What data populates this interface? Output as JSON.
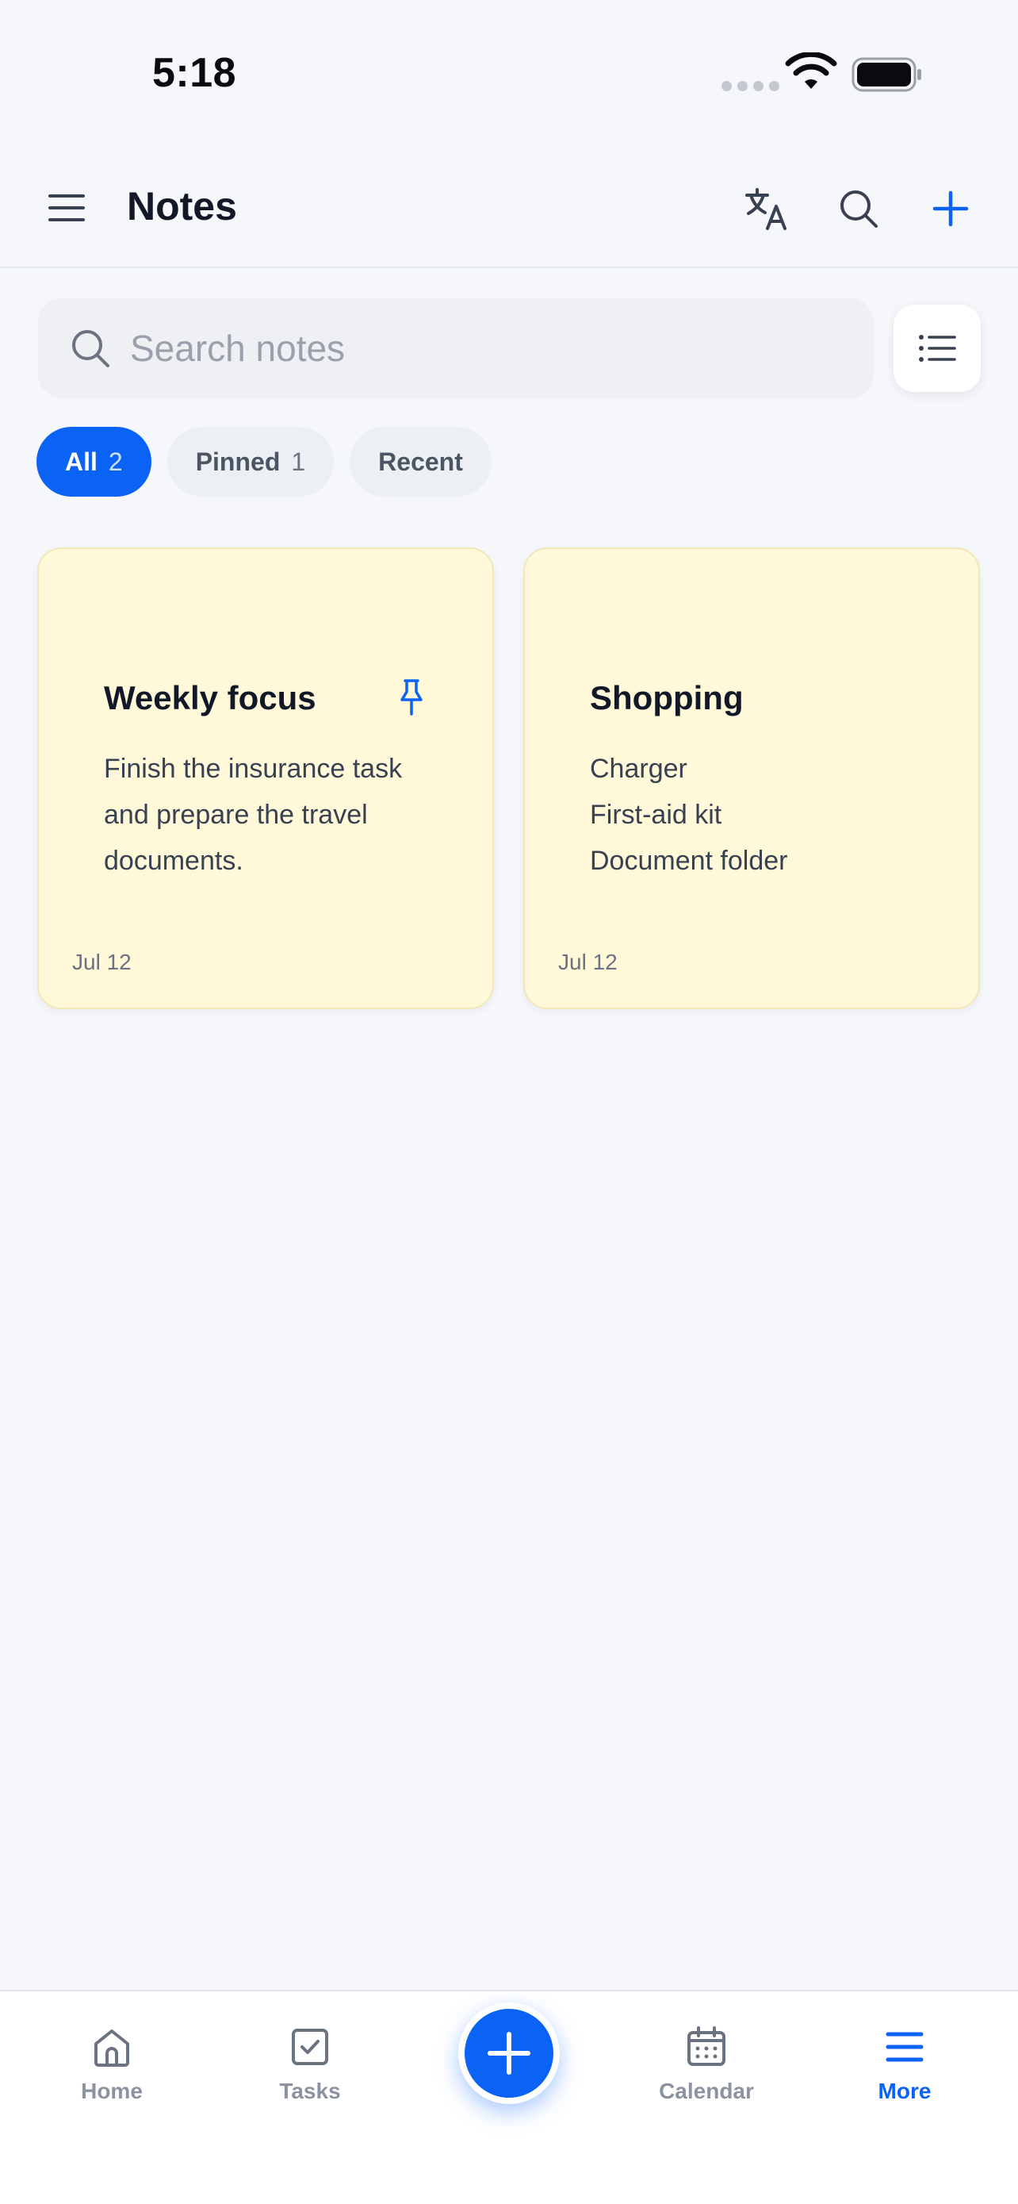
{
  "status_bar": {
    "time": "5:18"
  },
  "header": {
    "title": "Notes"
  },
  "search": {
    "placeholder": "Search notes",
    "value": ""
  },
  "filters": [
    {
      "label": "All",
      "count": "2",
      "active": true
    },
    {
      "label": "Pinned",
      "count": "1",
      "active": false
    },
    {
      "label": "Recent",
      "count": "",
      "active": false
    }
  ],
  "notes": [
    {
      "title": "Weekly focus",
      "pinned": true,
      "body": "Finish the insurance task and prepare the travel documents.",
      "date": "Jul 12",
      "color": "#fff8d9"
    },
    {
      "title": "Shopping",
      "pinned": false,
      "lines": [
        "Charger",
        "First-aid kit",
        "Document folder"
      ],
      "date": "Jul 12",
      "color": "#fff8d9"
    }
  ],
  "bottom_nav": {
    "items": [
      {
        "label": "Home",
        "icon": "home-icon",
        "active": false
      },
      {
        "label": "Tasks",
        "icon": "checkbox-icon",
        "active": false
      },
      {
        "label": "Calendar",
        "icon": "calendar-icon",
        "active": false
      },
      {
        "label": "More",
        "icon": "menu-icon",
        "active": true
      }
    ],
    "fab_icon": "plus-icon"
  },
  "colors": {
    "accent": "#0b63f6",
    "background": "#f5f7fb",
    "note": "#fff8d9"
  }
}
